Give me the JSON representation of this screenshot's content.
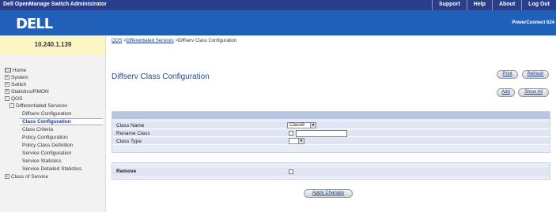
{
  "header": {
    "app_title": "Dell OpenManage Switch Administrator",
    "links": [
      "Support",
      "Help",
      "About",
      "Log Out"
    ],
    "logo": "DELL",
    "model": "PowerConnect 624"
  },
  "ip_address": "10.240.1.139",
  "breadcrumb": {
    "qos": "QOS",
    "sep1": " >",
    "diffserv": "Differentiated Services",
    "sep2": " >",
    "current": "Diffserv Class Configuration"
  },
  "sidebar": {
    "items": [
      {
        "label": "Home",
        "glyph": ""
      },
      {
        "label": "System",
        "glyph": "+"
      },
      {
        "label": "Switch",
        "glyph": "+"
      },
      {
        "label": "Statistics/RMON",
        "glyph": "+"
      },
      {
        "label": "QOS",
        "glyph": "-"
      },
      {
        "label": "Differentiated Services",
        "glyph": "-"
      },
      {
        "label": "Diffserv Configuration",
        "glyph": ""
      },
      {
        "label": "Class Configuration",
        "glyph": ""
      },
      {
        "label": "Class Criteria",
        "glyph": ""
      },
      {
        "label": "Policy Configuration",
        "glyph": ""
      },
      {
        "label": "Policy Class Definition",
        "glyph": ""
      },
      {
        "label": "Service Configuration",
        "glyph": ""
      },
      {
        "label": "Service Statistics",
        "glyph": ""
      },
      {
        "label": "Service Detailed Statistics",
        "glyph": ""
      },
      {
        "label": "Class of Service",
        "glyph": "+"
      }
    ]
  },
  "page_title": "Diffserv Class Configuration",
  "buttons": {
    "print": "Print",
    "refresh": "Refresh",
    "add": "Add",
    "show_all": "Show All",
    "apply": "Apply Changes"
  },
  "form": {
    "class_name_label": "Class Name",
    "class_name_value": "ClassB",
    "rename_label": "Rename Class",
    "rename_value": "",
    "class_type_label": "Class Type",
    "class_type_value": "",
    "remove_label": "Remove"
  }
}
